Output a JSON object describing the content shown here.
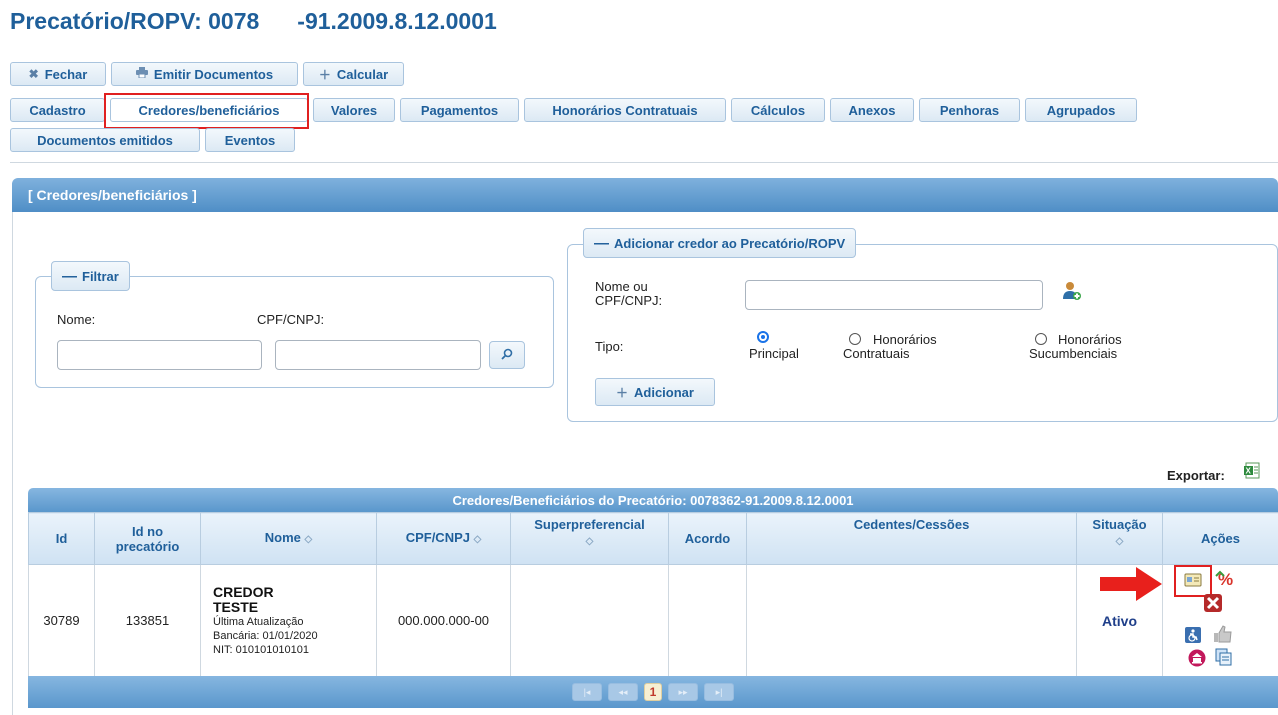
{
  "title": {
    "part1": "Precatório/ROPV: 0078",
    "part2": "-91.2009.8.12.0001"
  },
  "toolbar": {
    "close_label": "Fechar",
    "emit_label": "Emitir Documentos",
    "calc_label": "Calcular"
  },
  "tabs": [
    "Cadastro",
    "Credores/beneficiários",
    "Valores",
    "Pagamentos",
    "Honorários Contratuais",
    "Cálculos",
    "Anexos",
    "Penhoras",
    "Agrupados",
    "Documentos emitidos",
    "Eventos"
  ],
  "panel": {
    "title": "[ Credores/beneficiários ]"
  },
  "filter": {
    "legend": "Filtrar",
    "nome_label": "Nome:",
    "cpf_label": "CPF/CNPJ:",
    "nome_value": "",
    "cpf_value": ""
  },
  "add_creditor": {
    "legend": "Adicionar credor ao Precatório/ROPV",
    "name_label_1": "Nome ou",
    "name_label_2": "CPF/CNPJ:",
    "name_value": "",
    "tipo_label": "Tipo:",
    "options": [
      {
        "line1": "",
        "line2": "Principal",
        "selected": true
      },
      {
        "line1": "Honorários",
        "line2": "Contratuais",
        "selected": false
      },
      {
        "line1": "Honorários",
        "line2": "Sucumbenciais",
        "selected": false
      }
    ],
    "add_label": "Adicionar"
  },
  "export_label": "Exportar:",
  "grid": {
    "caption": "Credores/Beneficiários do Precatório: 0078362-91.2009.8.12.0001",
    "columns": {
      "id": "Id",
      "id_prec_1": "Id no",
      "id_prec_2": "precatório",
      "nome": "Nome",
      "cpf": "CPF/CNPJ",
      "superpref": "Superpreferencial",
      "acordo": "Acordo",
      "cedentes": "Cedentes/Cessões",
      "situacao": "Situação",
      "acoes": "Ações"
    },
    "rows": [
      {
        "id": "30789",
        "id_prec": "133851",
        "nome_1": "CREDOR",
        "nome_2": "TESTE",
        "sub_1": "Última Atualização",
        "sub_2": "Bancária: 01/01/2020",
        "sub_3": "NIT: 010101010101",
        "cpf": "000.000.000-00",
        "superpref": "",
        "acordo": "",
        "cedentes": "",
        "situacao": "Ativo"
      }
    ]
  },
  "pager": {
    "first": "|◂",
    "prev": "◂◂",
    "current": "1",
    "next": "▸▸",
    "last": "▸|"
  },
  "colors": {
    "accent": "#1f5f9a",
    "highlight": "#e02020",
    "header": "#5a97cc"
  }
}
